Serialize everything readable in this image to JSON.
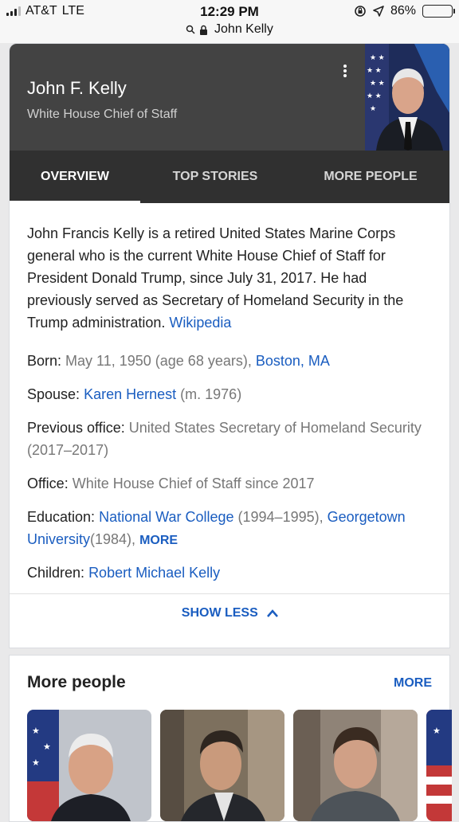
{
  "status_bar": {
    "carrier": "AT&T",
    "network": "LTE",
    "time": "12:29 PM",
    "battery": "86%",
    "battery_level": 0.86
  },
  "url_bar": {
    "query": "John Kelly"
  },
  "panel": {
    "name": "John F. Kelly",
    "role": "White House Chief of Staff",
    "tabs": [
      "OVERVIEW",
      "TOP STORIES",
      "MORE PEOPLE"
    ],
    "active_tab": "OVERVIEW",
    "description": "John Francis Kelly is a retired United States Marine Corps general who is the current White House Chief of Staff for President Donald Trump, since July 31, 2017. He had previously served as Secretary of Homeland Security in the Trump administration.",
    "source_link": "Wikipedia",
    "facts": {
      "born": {
        "label": "Born:",
        "value": "May 11, 1950 (age 68 years),",
        "link": "Boston, MA"
      },
      "spouse": {
        "label": "Spouse:",
        "link": "Karen Hernest",
        "value": "(m. 1976)"
      },
      "previous_office": {
        "label": "Previous office:",
        "value": "United States Secretary of Homeland Security (2017–2017)"
      },
      "office": {
        "label": "Office:",
        "value": "White House Chief of Staff since 2017"
      },
      "education": {
        "label": "Education:",
        "link1": "National War College",
        "value1": "(1994–1995),",
        "link2": "Georgetown University",
        "value2": "(1984),",
        "more": "MORE"
      },
      "children": {
        "label": "Children:",
        "link": "Robert Michael Kelly"
      }
    },
    "show_less": "SHOW LESS"
  },
  "more_people": {
    "title": "More people",
    "more": "MORE"
  },
  "colors": {
    "header_bg": "#434343",
    "tab_bg": "#303030",
    "link": "#1a5dc0"
  }
}
